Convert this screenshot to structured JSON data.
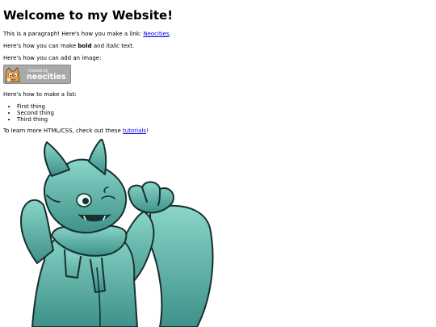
{
  "page": {
    "heading": "Welcome to my Website!",
    "para1": {
      "before": "This is a paragraph! Here's how you make a link: ",
      "link": "Neocities",
      "after": "."
    },
    "para2": {
      "before": "Here's how you can make ",
      "bold": "bold",
      "middle": " and ",
      "italic": "italic",
      "after": " text."
    },
    "para3": "Here's how you can add an image:",
    "badge": {
      "line1": "hosted by",
      "line2": "neocities"
    },
    "para4": "Here's how to make a list:",
    "list": [
      "First thing",
      "Second thing",
      "Third thing"
    ],
    "para5": {
      "before": "To learn more HTML/CSS, check out these ",
      "link": "tutorials",
      "after": "!"
    }
  },
  "colors": {
    "link": "#0000ee",
    "art_light": "#86d0c4",
    "art_dark": "#3d8f86",
    "badge_bg": "#a7a7a7"
  },
  "icons": [
    "neocities-cat-icon",
    "fox-character-illustration"
  ]
}
